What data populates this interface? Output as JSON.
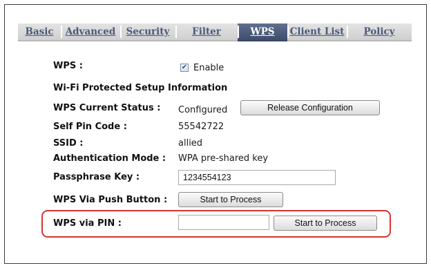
{
  "tabs": [
    {
      "label": "Basic",
      "active": false
    },
    {
      "label": "Advanced",
      "active": false
    },
    {
      "label": "Security",
      "active": false
    },
    {
      "label": "Filter",
      "active": false
    },
    {
      "label": "WPS",
      "active": true
    },
    {
      "label": "Client List",
      "active": false
    },
    {
      "label": "Policy",
      "active": false
    }
  ],
  "wps": {
    "label": "WPS :",
    "enable_label": "Enable",
    "enabled": true
  },
  "section_title": "Wi-Fi Protected Setup Information",
  "status": {
    "label": "WPS Current Status :",
    "value": "Configured",
    "release_button": "Release Configuration"
  },
  "self_pin": {
    "label": "Self Pin Code :",
    "value": "55542722"
  },
  "ssid": {
    "label": "SSID :",
    "value": "allied"
  },
  "auth_mode": {
    "label": "Authentication Mode :",
    "value": "WPA pre-shared key"
  },
  "passphrase": {
    "label": "Passphrase Key :",
    "value": "1234554123"
  },
  "push_button": {
    "label": "WPS Via Push Button :",
    "button": "Start to Process"
  },
  "pin": {
    "label": "WPS via PIN :",
    "value": "",
    "button": "Start to Process"
  },
  "colors": {
    "tab_active": "#4b5878",
    "tab_inactive": "#d9d9d9",
    "tab_text": "#4a5a7a",
    "highlight": "#d8332f"
  }
}
